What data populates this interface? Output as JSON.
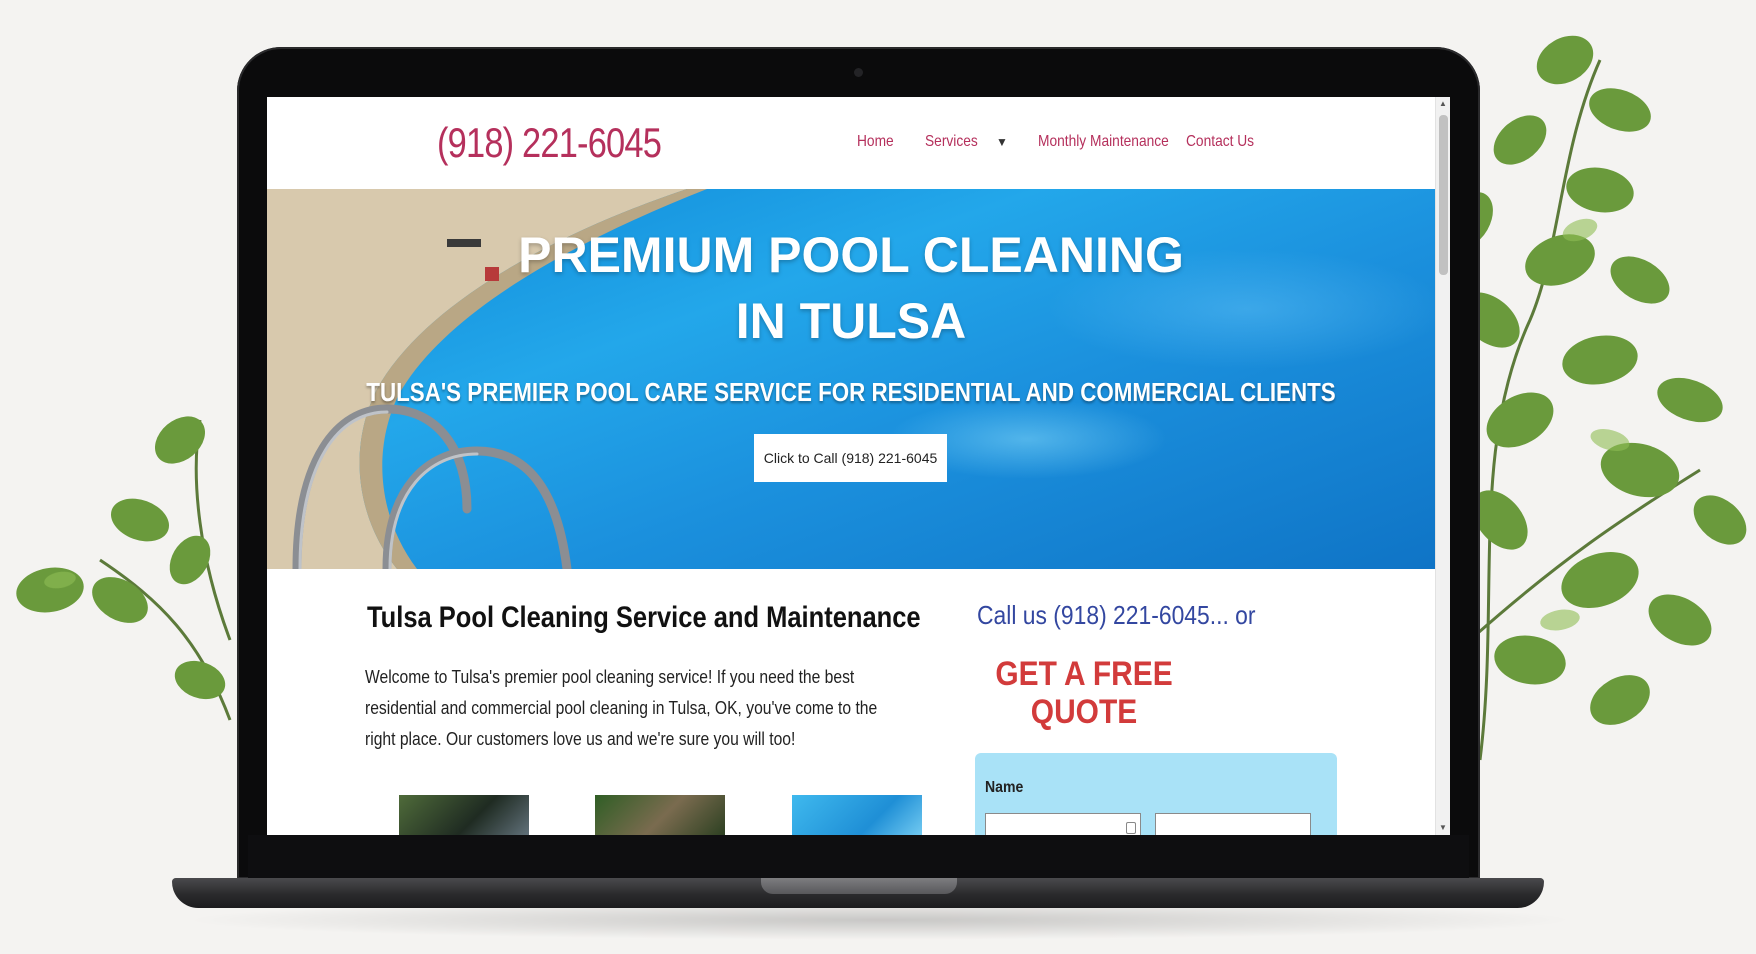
{
  "site": {
    "phone": "(918) 221-6045",
    "nav": {
      "home": "Home",
      "services": "Services",
      "services_caret": "▼",
      "monthly": "Monthly Maintenance",
      "contact": "Contact Us"
    }
  },
  "hero": {
    "title_line1": "PREMIUM POOL CLEANING",
    "title_line2": "IN TULSA",
    "subtitle": "TULSA'S PREMIER POOL CARE SERVICE FOR RESIDENTIAL AND COMMERCIAL CLIENTS",
    "cta_label": "Click to Call (918) 221-6045"
  },
  "content": {
    "heading": "Tulsa Pool Cleaning Service and Maintenance",
    "body": "Welcome to Tulsa's premier pool cleaning service! If you need the best residential and commercial pool cleaning in Tulsa, OK, you've come to the right place. Our customers love us and we're sure you will too!"
  },
  "sidebar": {
    "call_us": "Call us (918) 221-6045... or",
    "quote_line1": "GET A FREE",
    "quote_line2": "QUOTE",
    "form": {
      "name_label": "Name"
    }
  },
  "colors": {
    "brand": "#b5305c",
    "call_us": "#3347a0",
    "quote": "#d23b3b",
    "form_panel": "#a9e2f7"
  }
}
